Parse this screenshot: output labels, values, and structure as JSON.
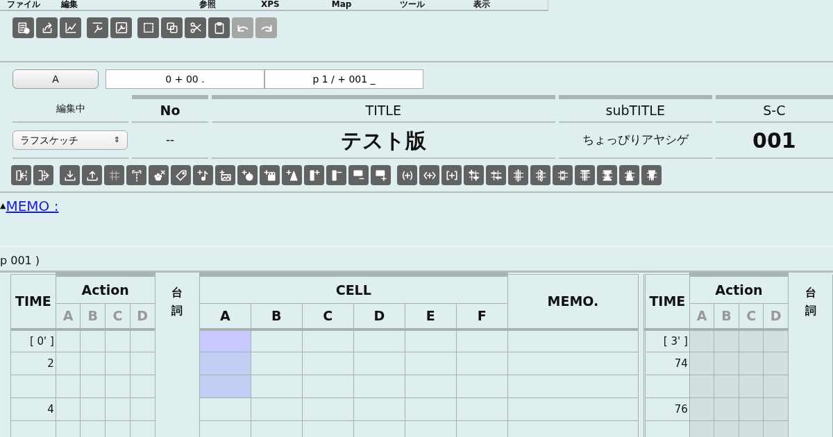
{
  "menu": [
    {
      "label": "ファイル"
    },
    {
      "label": "編集"
    },
    {
      "label": "参照"
    },
    {
      "label": "XPS"
    },
    {
      "label": "Map"
    },
    {
      "label": "ツール"
    },
    {
      "label": "表示"
    }
  ],
  "toolbar": [
    [
      {
        "kind": "sheet",
        "disabled": false
      },
      {
        "kind": "share",
        "disabled": false
      },
      {
        "kind": "chart",
        "disabled": false
      }
    ],
    [
      {
        "kind": "wrenchbar",
        "disabled": false
      },
      {
        "kind": "wrench",
        "disabled": false
      }
    ],
    [
      {
        "kind": "select",
        "disabled": false
      },
      {
        "kind": "copy",
        "disabled": false
      },
      {
        "kind": "cut",
        "disabled": false
      },
      {
        "kind": "paste",
        "disabled": false
      },
      {
        "kind": "undo",
        "disabled": true
      },
      {
        "kind": "redo",
        "disabled": true
      }
    ]
  ],
  "layer_button": "A",
  "frame_field": {
    "value": "0 + 00 ."
  },
  "page_field": {
    "value": "p 1 / + 001 _"
  },
  "header": {
    "status_label": "編集中",
    "mode_select": "ラフスケッチ",
    "mode_arrows": "⇕",
    "columns": [
      {
        "label": "No",
        "value": "--",
        "emphasis": false
      },
      {
        "label": "TITLE",
        "value": "テスト版",
        "emphasis": true
      },
      {
        "label": "subTITLE",
        "value": "ちょっぴりアヤシゲ",
        "emphasis": false
      },
      {
        "label": "S-C",
        "value": "001",
        "emphasis": true
      }
    ]
  },
  "edit_toolbar": [
    [
      {
        "kind": "insert-left",
        "disabled": false
      },
      {
        "kind": "insert-right",
        "disabled": false
      }
    ],
    [
      {
        "kind": "download",
        "disabled": false
      },
      {
        "kind": "upload",
        "disabled": false
      },
      {
        "kind": "grid",
        "disabled": true
      },
      {
        "kind": "bracket",
        "disabled": false
      },
      {
        "kind": "paw",
        "disabled": false
      },
      {
        "kind": "tag",
        "disabled": false
      },
      {
        "kind": "add-note",
        "disabled": false
      },
      {
        "kind": "add-image",
        "disabled": false
      },
      {
        "kind": "add-timer",
        "disabled": false
      },
      {
        "kind": "add-camera",
        "disabled": false
      },
      {
        "kind": "add-tree",
        "disabled": false
      },
      {
        "kind": "col-add",
        "disabled": false
      },
      {
        "kind": "col-remove",
        "disabled": false
      },
      {
        "kind": "row-remove",
        "disabled": false
      },
      {
        "kind": "row-add",
        "disabled": false
      }
    ],
    [
      {
        "kind": "paren-plus",
        "disabled": false
      },
      {
        "kind": "angle-plus",
        "disabled": false
      },
      {
        "kind": "bracket-plus",
        "disabled": false
      },
      {
        "kind": "grid-plus",
        "disabled": false
      },
      {
        "kind": "grid-minus",
        "disabled": false
      },
      {
        "kind": "grid-lines",
        "disabled": false
      },
      {
        "kind": "grid-zigzag",
        "disabled": false
      },
      {
        "kind": "grid-dots",
        "disabled": false
      },
      {
        "kind": "grid-t",
        "disabled": false
      },
      {
        "kind": "grid-hourglass",
        "disabled": false
      },
      {
        "kind": "grid-triangle",
        "disabled": false
      },
      {
        "kind": "grid-v",
        "disabled": false
      }
    ]
  ],
  "memo": {
    "toggle": "▲",
    "label": "MEMO :"
  },
  "page_label": "p 001 )",
  "sheet": {
    "left": {
      "time_header": "TIME",
      "action_header": "Action",
      "action_columns": [
        "A",
        "B",
        "C",
        "D"
      ],
      "dialog_header": "台詞",
      "cell_header": "CELL",
      "cell_columns": [
        "A",
        "B",
        "C",
        "D",
        "E",
        "F"
      ],
      "memo_header": "MEMO.",
      "shaded": false,
      "rows": [
        {
          "time": "[ 0' ]",
          "cursor": true,
          "selected": true
        },
        {
          "time": "2",
          "cursor": false,
          "selected": true
        },
        {
          "cursor": false,
          "selected": true
        },
        {
          "time": "4",
          "cursor": false,
          "selected": false
        },
        {
          "cursor": false,
          "selected": false
        }
      ]
    },
    "right": {
      "time_header": "TIME",
      "action_header": "Action",
      "action_columns": [
        "A",
        "B",
        "C",
        "D"
      ],
      "dialog_header": "台詞",
      "shaded": true,
      "rows": [
        {
          "time": "[ 3' ]"
        },
        {
          "time": "74"
        },
        {},
        {
          "time": "76"
        },
        {}
      ]
    }
  }
}
